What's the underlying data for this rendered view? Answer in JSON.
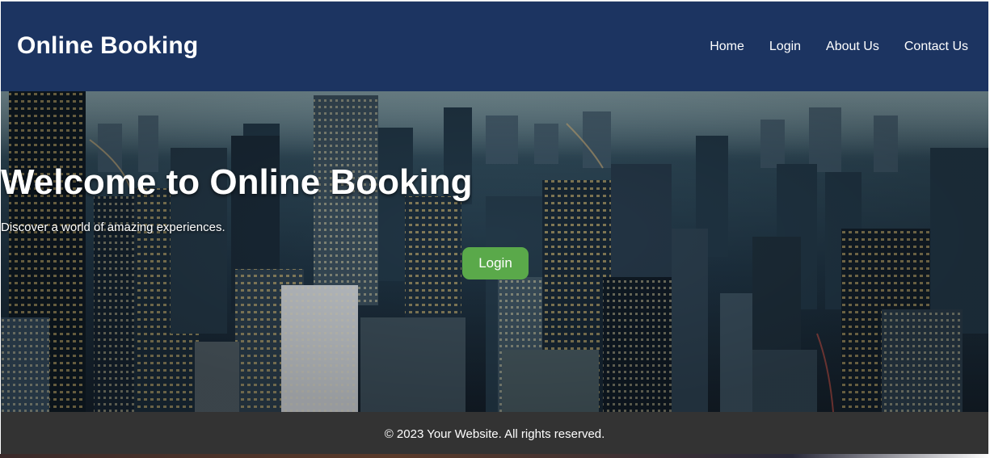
{
  "header": {
    "brand": "Online Booking",
    "nav": [
      "Home",
      "Login",
      "About Us",
      "Contact Us"
    ]
  },
  "hero": {
    "title": "Welcome to Online Booking",
    "subtitle": "Discover a world of amazing experiences.",
    "button_label": "Login"
  },
  "footer": {
    "text": "© 2023 Your Website. All rights reserved."
  },
  "colors": {
    "header_bg": "#1c3461",
    "footer_bg": "#333333",
    "button_bg": "#5aa94a"
  }
}
